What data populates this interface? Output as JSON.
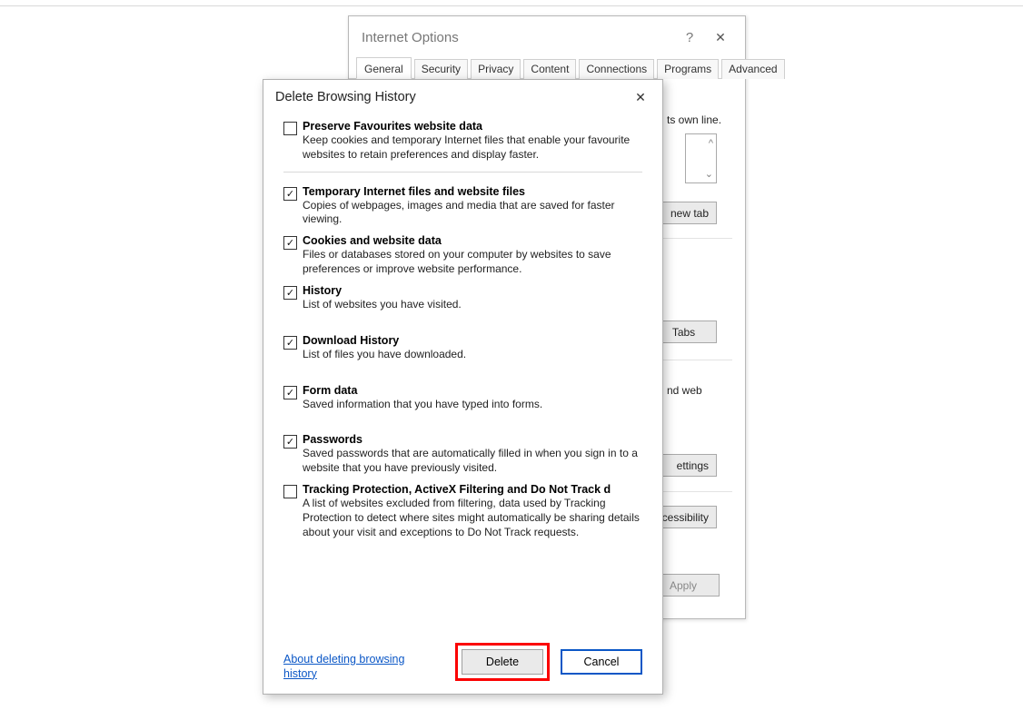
{
  "internet_options": {
    "title": "Internet Options",
    "tabs": [
      "General",
      "Security",
      "Privacy",
      "Content",
      "Connections",
      "Programs",
      "Advanced"
    ],
    "active_tab": 0,
    "homepage_hint": "ts own line.",
    "buttons": {
      "new_tab": "new tab",
      "tabs": "Tabs",
      "settings": "ettings",
      "accessibility": "cessibility",
      "apply": "Apply"
    },
    "and_web": "nd web"
  },
  "delete_history": {
    "title": "Delete Browsing History",
    "options": {
      "preserve": {
        "checked": false,
        "label": "Preserve Favourites website data",
        "desc": "Keep cookies and temporary Internet files that enable your favourite websites to retain preferences and display faster."
      },
      "temp": {
        "checked": true,
        "label": "Temporary Internet files and website files",
        "desc": "Copies of webpages, images and media that are saved for faster viewing."
      },
      "cookies": {
        "checked": true,
        "label": "Cookies and website data",
        "desc": "Files or databases stored on your computer by websites to save preferences or improve website performance."
      },
      "history": {
        "checked": true,
        "label": "History",
        "desc": "List of websites you have visited."
      },
      "download": {
        "checked": true,
        "label": "Download History",
        "desc": "List of files you have downloaded."
      },
      "form": {
        "checked": true,
        "label": "Form data",
        "desc": "Saved information that you have typed into forms."
      },
      "passwords": {
        "checked": true,
        "label": "Passwords",
        "desc": "Saved passwords that are automatically filled in when you sign in to a website that you have previously visited."
      },
      "tracking": {
        "checked": false,
        "label": "Tracking Protection, ActiveX Filtering and Do Not Track d",
        "desc": "A list of websites excluded from filtering, data used by Tracking Protection to detect where sites might automatically be sharing details about your visit and exceptions to Do Not Track requests."
      }
    },
    "link": "About deleting browsing history",
    "buttons": {
      "delete": "Delete",
      "cancel": "Cancel"
    }
  }
}
